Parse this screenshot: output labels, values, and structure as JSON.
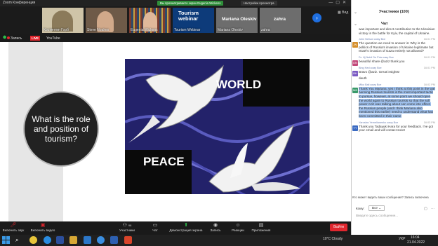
{
  "window": {
    "title": "Zoom Конференция",
    "view_badge": "Вы просматриваете экран Eugenia Wickens",
    "view_options": "Настройки просмотра"
  },
  "gallery": {
    "participants": [
      {
        "name": "Костянтин Горб"
      },
      {
        "name": "Steve Noakes"
      },
      {
        "name": "Eugenia Wickens"
      },
      {
        "name": "Tourism Webinar"
      },
      {
        "name": "Mariana Oleskiv"
      },
      {
        "name": "zahra"
      }
    ],
    "tile_title": "Tourism webinar",
    "view_mode": "Вид"
  },
  "status": {
    "record_label": "Запись",
    "live_badge": "LIVE",
    "youtube": "YouTube"
  },
  "slide": {
    "question": "What is the role and position of tourism?",
    "word_top": "WORLD",
    "word_bottom": "PEACE"
  },
  "toolbar": {
    "mute": "Включить звук",
    "video": "Включить видео",
    "participants": "Участники",
    "participants_count": "98",
    "chat": "Чат",
    "share": "Демонстрация экрана",
    "record": "Запись",
    "reactions": "Реакции",
    "apps": "Приложения",
    "leave": "Выйти"
  },
  "chat_panel": {
    "participants_header": "Участники (100)",
    "chat_header": "Чат",
    "messages": [
      {
        "sender": "",
        "body": "was important and direct contribution to the Ukrainian victory in the battle for Kyiv, the capital of Ukraine.",
        "initials": "",
        "time": ""
      },
      {
        "sender": "John Nelson кому Все",
        "body": "The question we need to answer is: Why is the politics of Russia's invasion of Ukraine legitimate but Israel's invasion of Gaza entirely not allowed?",
        "initials": "JN",
        "time": "16:01 PM"
      },
      {
        "sender": "Dr. Hj Nabil De Pria кому Все",
        "body": "beautiful share @aziz thank you",
        "initials": "DN",
        "time": "16:01 PM"
      },
      {
        "sender": "Bing Hari кому Все",
        "body": "Bravo @aziz. Great insights!",
        "initials": "BH",
        "time": "16:01 PM"
      },
      {
        "sender": "",
        "body": "dauth",
        "initials": "",
        "time": ""
      },
      {
        "sender": "Miko Bali кому Все",
        "body": "Thank You Mariana, yes I think at this point in the war banning Russian tourists is the most important tactic to pursue, however, at some point we should open the world again to Russian tourists so that the soft power Aziz was talking about can come into effect. the Russian people (and I think Mariana also mentioned this earlier) need to understand what has been committed in their name",
        "initials": "MB",
        "time": "16:02 PM"
      },
      {
        "sender": "Yaroslav Yemelianenko кому Все",
        "body": "Thank you Tadayuki Hara for your feedback. I've got your email and will contact soon!",
        "initials": "YY",
        "time": "16:03 PM"
      }
    ],
    "visibility_notice": "Кто может видеть ваши сообщения? Запись включена",
    "to_label": "Кому:",
    "to_value": "Все",
    "input_placeholder": "Введите здесь сообщение..."
  },
  "taskbar": {
    "weather": "10°C Cloudy",
    "lang": "УКР",
    "time": "16:04",
    "date": "21.04.2022"
  },
  "colors": {
    "accent": "#1f6fe0",
    "leave": "#e0262e",
    "live": "#e0262e",
    "shield": "#2dbd4a",
    "highlight": "#9fc0ec"
  }
}
